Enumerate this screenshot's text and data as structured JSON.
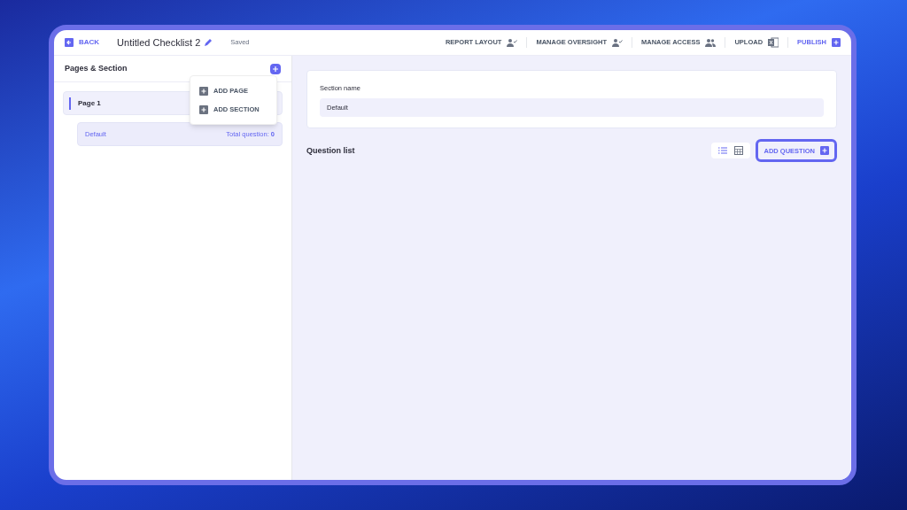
{
  "header": {
    "back": "BACK",
    "title": "Untitled Checklist 2",
    "status": "Saved",
    "actions": [
      {
        "label": "REPORT LAYOUT",
        "kind": "person-check"
      },
      {
        "label": "MANAGE OVERSIGHT",
        "kind": "person-check"
      },
      {
        "label": "MANAGE ACCESS",
        "kind": "people"
      },
      {
        "label": "UPLOAD",
        "kind": "excel"
      },
      {
        "label": "PUBLISH",
        "kind": "plus"
      }
    ]
  },
  "sidebar": {
    "title": "Pages & Section",
    "pages": [
      {
        "label": "Page 1",
        "selected": true,
        "sections": [
          {
            "label": "Default",
            "count_label": "Total question:",
            "count": "0"
          }
        ]
      }
    ]
  },
  "add_menu": {
    "items": [
      "ADD PAGE",
      "ADD SECTION"
    ]
  },
  "section_form": {
    "label": "Section name",
    "value": "Default"
  },
  "question_list": {
    "title": "Question list",
    "views": [
      {
        "kind": "list",
        "selected": true
      },
      {
        "kind": "table",
        "selected": false
      }
    ],
    "add_button": "ADD QUESTION"
  }
}
